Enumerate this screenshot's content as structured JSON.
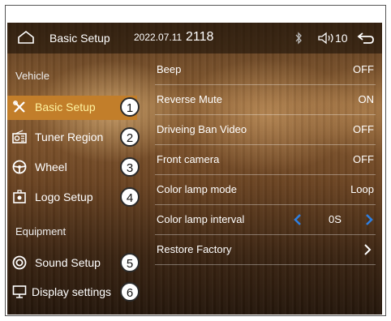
{
  "header": {
    "title": "Basic Setup",
    "date": "2022.07.11",
    "time": "2118",
    "volume": "10",
    "home_icon": "home-outline-icon",
    "bluetooth_icon": "bluetooth-icon",
    "volume_icon": "speaker-icon",
    "back_icon": "return-arrow-icon"
  },
  "sidebar": {
    "section_vehicle": "Vehicle",
    "section_equipment": "Equipment",
    "items": [
      {
        "label": "Basic Setup",
        "callout": "1",
        "icon": "tools-icon",
        "active": true
      },
      {
        "label": "Tuner Region",
        "callout": "2",
        "icon": "radio-icon",
        "active": false
      },
      {
        "label": "Wheel",
        "callout": "3",
        "icon": "steering-wheel-icon",
        "active": false
      },
      {
        "label": "Logo Setup",
        "callout": "4",
        "icon": "logo-image-icon",
        "active": false
      },
      {
        "label": "Sound Setup",
        "callout": "5",
        "icon": "sound-icon",
        "active": false
      },
      {
        "label": "Display settings",
        "callout": "6",
        "icon": "monitor-icon",
        "active": false
      }
    ]
  },
  "settings": [
    {
      "label": "Beep",
      "value": "OFF"
    },
    {
      "label": "Reverse Mute",
      "value": "ON"
    },
    {
      "label": "Driveing Ban Video",
      "value": "OFF"
    },
    {
      "label": "Front camera",
      "value": "OFF"
    },
    {
      "label": "Color lamp mode",
      "value": "Loop"
    },
    {
      "label": "Color lamp interval",
      "value": "0S"
    },
    {
      "label": "Restore Factory",
      "value": ""
    }
  ],
  "colors": {
    "active_bg": "#c27e2a",
    "active_text": "#fff3a0",
    "arrow_blue": "#2f7fe0"
  }
}
